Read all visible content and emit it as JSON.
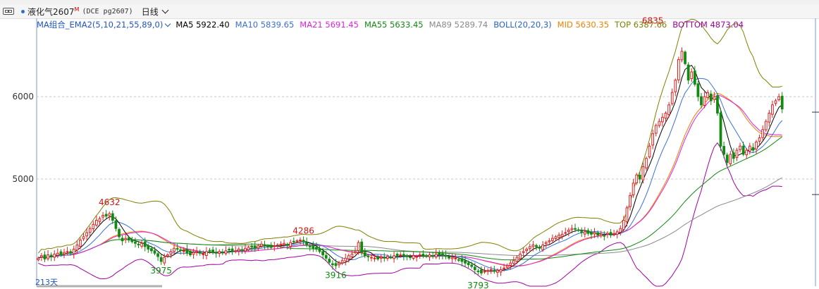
{
  "toolbar": {
    "symbol": "液化气2607",
    "symbol_mark": "M",
    "code": "(DCE pg2607)",
    "period": "日线"
  },
  "legend": {
    "combo_label": "MA组合_EMA2(5,10,21,55,89,0)",
    "items": [
      {
        "label": "MA5",
        "value": "5922.40",
        "color": "#000000"
      },
      {
        "label": "MA10",
        "value": "5839.65",
        "color": "#3a6fd8"
      },
      {
        "label": "MA21",
        "value": "5691.45",
        "color": "#e020e0"
      },
      {
        "label": "MA55",
        "value": "5633.45",
        "color": "#108a10"
      },
      {
        "label": "MA89",
        "value": "5289.74",
        "color": "#8a8a8a"
      },
      {
        "label": "BOLL(20,20,3)",
        "value": "",
        "color": "#2a62c9"
      },
      {
        "label": "MID",
        "value": "5630.35",
        "color": "#f08000"
      },
      {
        "label": "TOP",
        "value": "6387.66",
        "color": "#808000"
      },
      {
        "label": "BOTTOM",
        "value": "4873.04",
        "color": "#a000a0"
      }
    ]
  },
  "bottom_label": "213天",
  "chart_data": {
    "type": "candlestick",
    "title": "",
    "xlabel": "",
    "ylabel": "",
    "ylim": [
      3700,
      6950
    ],
    "yticks": [
      5000,
      6000
    ],
    "grid": "horizontal dashed at ticks",
    "annotations": [
      {
        "text": "4632",
        "value": 4632,
        "kind": "high",
        "index": 22
      },
      {
        "text": "3975",
        "value": 3975,
        "kind": "low",
        "index": 38
      },
      {
        "text": "4286",
        "value": 4286,
        "kind": "high",
        "index": 82
      },
      {
        "text": "3916",
        "value": 3916,
        "kind": "low",
        "index": 92
      },
      {
        "text": "3793",
        "value": 3793,
        "kind": "low",
        "index": 136
      },
      {
        "text": "6835",
        "value": 6835,
        "kind": "high",
        "index": 190
      }
    ],
    "up_color": "#e02020",
    "down_color": "#108a10",
    "close": [
      4040,
      4070,
      4030,
      4080,
      4060,
      4090,
      4100,
      4080,
      4110,
      4120,
      4100,
      4150,
      4200,
      4260,
      4300,
      4350,
      4400,
      4450,
      4500,
      4520,
      4560,
      4550,
      4580,
      4500,
      4400,
      4300,
      4250,
      4280,
      4260,
      4240,
      4220,
      4200,
      4220,
      4180,
      4150,
      4130,
      4100,
      4060,
      4000,
      4050,
      4080,
      4120,
      4160,
      4150,
      4140,
      4130,
      4100,
      4080,
      4110,
      4120,
      4100,
      4090,
      4120,
      4130,
      4110,
      4100,
      4120,
      4110,
      4130,
      4140,
      4120,
      4130,
      4150,
      4140,
      4160,
      4170,
      4180,
      4160,
      4190,
      4210,
      4200,
      4180,
      4170,
      4190,
      4200,
      4210,
      4220,
      4200,
      4230,
      4240,
      4250,
      4260,
      4240,
      4200,
      4180,
      4160,
      4150,
      4120,
      4080,
      4040,
      3990,
      3960,
      3950,
      3980,
      4010,
      4040,
      4070,
      4090,
      4120,
      4230,
      4110,
      4070,
      4060,
      4050,
      4040,
      4030,
      4050,
      4040,
      4060,
      4050,
      4070,
      4060,
      4080,
      4070,
      4060,
      4050,
      4070,
      4060,
      4080,
      4070,
      4060,
      4080,
      4070,
      4090,
      4080,
      4070,
      4060,
      4040,
      4050,
      4040,
      4020,
      4000,
      3980,
      3960,
      3940,
      3900,
      3880,
      3860,
      3880,
      3890,
      3900,
      3880,
      3890,
      3900,
      3920,
      3950,
      3980,
      4010,
      4050,
      4090,
      4120,
      4150,
      4180,
      4200,
      4180,
      4160,
      4200,
      4230,
      4250,
      4280,
      4300,
      4320,
      4330,
      4350,
      4380,
      4400,
      4390,
      4380,
      4350,
      4360,
      4340,
      4330,
      4350,
      4320,
      4330,
      4310,
      4340,
      4320,
      4330,
      4360,
      4400,
      4500,
      4650,
      4800,
      4950,
      5050,
      5000,
      5150,
      5250,
      5400,
      5550,
      5650,
      5700,
      5750,
      5800,
      5900,
      6050,
      6200,
      6450,
      6550,
      6400,
      6200,
      6300,
      6150,
      6000,
      5900,
      6000,
      6050,
      5950,
      6000,
      5800,
      5400,
      5300,
      5200,
      5300,
      5250,
      5350,
      5400,
      5300,
      5350,
      5400,
      5350,
      5450,
      5500,
      5600,
      5700,
      5800,
      5900,
      5950,
      6000,
      5850
    ]
  }
}
